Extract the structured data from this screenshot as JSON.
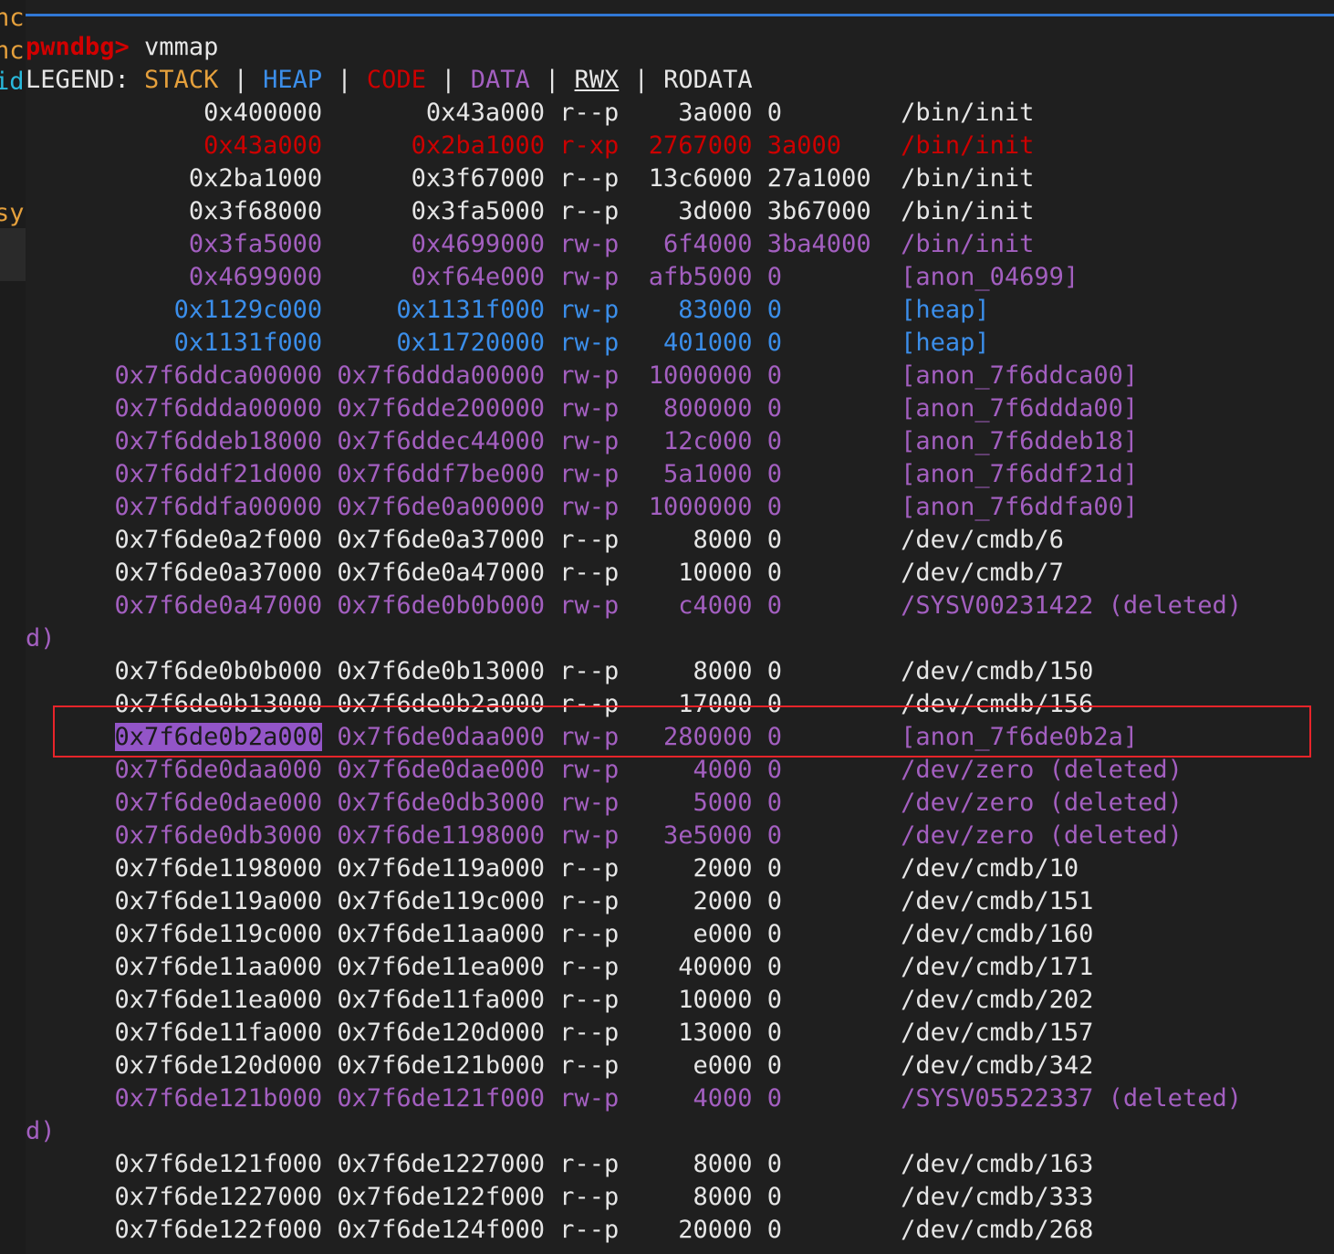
{
  "window": {
    "background": "#1f1f1f",
    "accent_rule_color": "#3178d6",
    "annotation_box_color": "#e8242a",
    "highlight_background": "#9355c8"
  },
  "edge_fragments": [
    {
      "text": "nc",
      "color": "#e5a03c"
    },
    {
      "text": "nc",
      "color": "#e5a03c"
    },
    {
      "text": "id",
      "color": "#29b8db"
    },
    {
      "text": "sy",
      "color": "#e5a03c"
    }
  ],
  "prompt": {
    "symbol": "pwndbg>",
    "command": "vmmap"
  },
  "legend": {
    "label": "LEGEND:",
    "entries": [
      {
        "name": "STACK",
        "color": "#e5a03c"
      },
      {
        "name": "HEAP",
        "color": "#3b8eea"
      },
      {
        "name": "CODE",
        "color": "#cc0000"
      },
      {
        "name": "DATA",
        "color": "#a35fc0"
      },
      {
        "name": "RWX",
        "color": "#e6e6e6"
      },
      {
        "name": "RODATA",
        "color": "#e6e6e6"
      }
    ],
    "separator": "|"
  },
  "table": {
    "rows": [
      {
        "start": "0x400000",
        "end": "0x43a000",
        "perm": "r--p",
        "size": "3a000",
        "offset": "0",
        "objfile": "/bin/init",
        "kind": "white"
      },
      {
        "start": "0x43a000",
        "end": "0x2ba1000",
        "perm": "r-xp",
        "size": "2767000",
        "offset": "3a000",
        "objfile": "/bin/init",
        "kind": "code"
      },
      {
        "start": "0x2ba1000",
        "end": "0x3f67000",
        "perm": "r--p",
        "size": "13c6000",
        "offset": "27a1000",
        "objfile": "/bin/init",
        "kind": "white"
      },
      {
        "start": "0x3f68000",
        "end": "0x3fa5000",
        "perm": "r--p",
        "size": "3d000",
        "offset": "3b67000",
        "objfile": "/bin/init",
        "kind": "white"
      },
      {
        "start": "0x3fa5000",
        "end": "0x4699000",
        "perm": "rw-p",
        "size": "6f4000",
        "offset": "3ba4000",
        "objfile": "/bin/init",
        "kind": "data"
      },
      {
        "start": "0x4699000",
        "end": "0xf64e000",
        "perm": "rw-p",
        "size": "afb5000",
        "offset": "0",
        "objfile": "[anon_04699]",
        "kind": "data"
      },
      {
        "start": "0x1129c000",
        "end": "0x1131f000",
        "perm": "rw-p",
        "size": "83000",
        "offset": "0",
        "objfile": "[heap]",
        "kind": "heap"
      },
      {
        "start": "0x1131f000",
        "end": "0x11720000",
        "perm": "rw-p",
        "size": "401000",
        "offset": "0",
        "objfile": "[heap]",
        "kind": "heap"
      },
      {
        "start": "0x7f6ddca00000",
        "end": "0x7f6ddda00000",
        "perm": "rw-p",
        "size": "1000000",
        "offset": "0",
        "objfile": "[anon_7f6ddca00]",
        "kind": "data"
      },
      {
        "start": "0x7f6ddda00000",
        "end": "0x7f6dde200000",
        "perm": "rw-p",
        "size": "800000",
        "offset": "0",
        "objfile": "[anon_7f6ddda00]",
        "kind": "data"
      },
      {
        "start": "0x7f6ddeb18000",
        "end": "0x7f6ddec44000",
        "perm": "rw-p",
        "size": "12c000",
        "offset": "0",
        "objfile": "[anon_7f6ddeb18]",
        "kind": "data"
      },
      {
        "start": "0x7f6ddf21d000",
        "end": "0x7f6ddf7be000",
        "perm": "rw-p",
        "size": "5a1000",
        "offset": "0",
        "objfile": "[anon_7f6ddf21d]",
        "kind": "data"
      },
      {
        "start": "0x7f6ddfa00000",
        "end": "0x7f6de0a00000",
        "perm": "rw-p",
        "size": "1000000",
        "offset": "0",
        "objfile": "[anon_7f6ddfa00]",
        "kind": "data"
      },
      {
        "start": "0x7f6de0a2f000",
        "end": "0x7f6de0a37000",
        "perm": "r--p",
        "size": "8000",
        "offset": "0",
        "objfile": "/dev/cmdb/6",
        "kind": "white"
      },
      {
        "start": "0x7f6de0a37000",
        "end": "0x7f6de0a47000",
        "perm": "r--p",
        "size": "10000",
        "offset": "0",
        "objfile": "/dev/cmdb/7",
        "kind": "white"
      },
      {
        "start": "0x7f6de0a47000",
        "end": "0x7f6de0b0b000",
        "perm": "rw-p",
        "size": "c4000",
        "offset": "0",
        "objfile": "/SYSV00231422 (deleted)",
        "kind": "data",
        "wrap": true
      },
      {
        "start": "0x7f6de0b0b000",
        "end": "0x7f6de0b13000",
        "perm": "r--p",
        "size": "8000",
        "offset": "0",
        "objfile": "/dev/cmdb/150",
        "kind": "white"
      },
      {
        "start": "0x7f6de0b13000",
        "end": "0x7f6de0b2a000",
        "perm": "r--p",
        "size": "17000",
        "offset": "0",
        "objfile": "/dev/cmdb/156",
        "kind": "white"
      },
      {
        "start": "0x7f6de0b2a000",
        "end": "0x7f6de0daa000",
        "perm": "rw-p",
        "size": "280000",
        "offset": "0",
        "objfile": "[anon_7f6de0b2a]",
        "kind": "data",
        "highlight_start": true
      },
      {
        "start": "0x7f6de0daa000",
        "end": "0x7f6de0dae000",
        "perm": "rw-p",
        "size": "4000",
        "offset": "0",
        "objfile": "/dev/zero (deleted)",
        "kind": "data"
      },
      {
        "start": "0x7f6de0dae000",
        "end": "0x7f6de0db3000",
        "perm": "rw-p",
        "size": "5000",
        "offset": "0",
        "objfile": "/dev/zero (deleted)",
        "kind": "data"
      },
      {
        "start": "0x7f6de0db3000",
        "end": "0x7f6de1198000",
        "perm": "rw-p",
        "size": "3e5000",
        "offset": "0",
        "objfile": "/dev/zero (deleted)",
        "kind": "data"
      },
      {
        "start": "0x7f6de1198000",
        "end": "0x7f6de119a000",
        "perm": "r--p",
        "size": "2000",
        "offset": "0",
        "objfile": "/dev/cmdb/10",
        "kind": "white"
      },
      {
        "start": "0x7f6de119a000",
        "end": "0x7f6de119c000",
        "perm": "r--p",
        "size": "2000",
        "offset": "0",
        "objfile": "/dev/cmdb/151",
        "kind": "white"
      },
      {
        "start": "0x7f6de119c000",
        "end": "0x7f6de11aa000",
        "perm": "r--p",
        "size": "e000",
        "offset": "0",
        "objfile": "/dev/cmdb/160",
        "kind": "white"
      },
      {
        "start": "0x7f6de11aa000",
        "end": "0x7f6de11ea000",
        "perm": "r--p",
        "size": "40000",
        "offset": "0",
        "objfile": "/dev/cmdb/171",
        "kind": "white"
      },
      {
        "start": "0x7f6de11ea000",
        "end": "0x7f6de11fa000",
        "perm": "r--p",
        "size": "10000",
        "offset": "0",
        "objfile": "/dev/cmdb/202",
        "kind": "white"
      },
      {
        "start": "0x7f6de11fa000",
        "end": "0x7f6de120d000",
        "perm": "r--p",
        "size": "13000",
        "offset": "0",
        "objfile": "/dev/cmdb/157",
        "kind": "white"
      },
      {
        "start": "0x7f6de120d000",
        "end": "0x7f6de121b000",
        "perm": "r--p",
        "size": "e000",
        "offset": "0",
        "objfile": "/dev/cmdb/342",
        "kind": "white"
      },
      {
        "start": "0x7f6de121b000",
        "end": "0x7f6de121f000",
        "perm": "rw-p",
        "size": "4000",
        "offset": "0",
        "objfile": "/SYSV05522337 (deleted)",
        "kind": "data",
        "wrap": true
      },
      {
        "start": "0x7f6de121f000",
        "end": "0x7f6de1227000",
        "perm": "r--p",
        "size": "8000",
        "offset": "0",
        "objfile": "/dev/cmdb/163",
        "kind": "white"
      },
      {
        "start": "0x7f6de1227000",
        "end": "0x7f6de122f000",
        "perm": "r--p",
        "size": "8000",
        "offset": "0",
        "objfile": "/dev/cmdb/333",
        "kind": "white"
      },
      {
        "start": "0x7f6de122f000",
        "end": "0x7f6de124f000",
        "perm": "r--p",
        "size": "20000",
        "offset": "0",
        "objfile": "/dev/cmdb/268",
        "kind": "white"
      }
    ],
    "wrap_continuation": "d)"
  }
}
